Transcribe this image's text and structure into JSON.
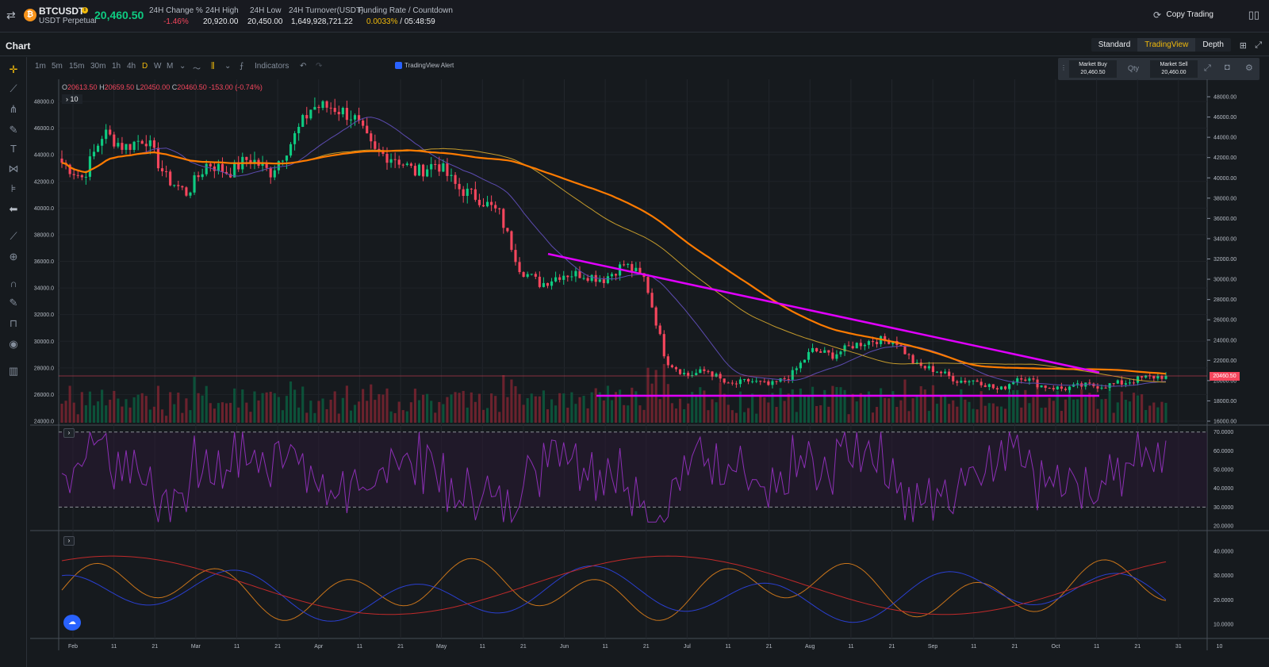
{
  "header": {
    "swap_icon": "swap-arrows-icon",
    "coin_icon": "bitcoin-icon",
    "coin_glyph": "₿",
    "info_glyph": "i",
    "symbol": "BTCUSDT",
    "subtitle": "USDT Perpetual",
    "last_price": "20,460.50",
    "stats": [
      {
        "label": "24H Change %",
        "value": "-1.46%"
      },
      {
        "label": "24H High",
        "value": "20,920.00"
      },
      {
        "label": "24H Low",
        "value": "20,450.00"
      },
      {
        "label": "24H Turnover(USDT)",
        "value": "1,649,928,721.22"
      }
    ],
    "funding": {
      "label": "Funding Rate / Countdown",
      "rate": "0.0033%",
      "countdown": " / 05:48:59"
    },
    "copy_trading": "Copy Trading"
  },
  "chart_panel": {
    "title": "Chart",
    "view_tabs": [
      "Standard",
      "TradingView",
      "Depth"
    ],
    "active_view": "TradingView"
  },
  "toolbar": {
    "timeframes": [
      "1m",
      "5m",
      "15m",
      "30m",
      "1h",
      "4h",
      "D",
      "W",
      "M"
    ],
    "active_timeframe": "D",
    "indicators_label": "Indicators",
    "tv_alert": "TradingView Alert"
  },
  "quick_trade": {
    "buy_label": "Market Buy",
    "buy_price": "20,460.50",
    "qty_label": "Qty",
    "sell_label": "Market Sell",
    "sell_price": "20,460.00"
  },
  "legend": {
    "o_label": "O",
    "o": "20613.50",
    "h_label": "H",
    "h": "20659.50",
    "l_label": "L",
    "l": "20450.00",
    "c_label": "C",
    "c": "20460.50",
    "change": "-153.00 (-0.74%)",
    "study_count": "10"
  },
  "current_price_tag": "20460.50",
  "colors": {
    "up": "#0ecb81",
    "down": "#f6465d",
    "accent": "#f0b90b",
    "trendline": "#e100ff",
    "ema_orange": "#ff7b00",
    "ema_gold": "#c49a2c",
    "ema_purple": "#5c4bb0"
  },
  "chart_data": {
    "type": "candlestick",
    "price_axis_left": [
      "48000.0",
      "46000.0",
      "44000.0",
      "42000.0",
      "40000.0",
      "38000.0",
      "36000.0",
      "34000.0",
      "32000.0",
      "30000.0",
      "28000.0",
      "26000.0",
      "24000.0"
    ],
    "price_axis_right": [
      "48000.00",
      "46000.00",
      "44000.00",
      "42000.00",
      "40000.00",
      "38000.00",
      "36000.00",
      "34000.00",
      "32000.00",
      "30000.00",
      "28000.00",
      "26000.00",
      "24000.00",
      "22000.00",
      "20000.00",
      "18000.00",
      "16000.00"
    ],
    "rsi_axis": [
      "70.0000",
      "60.0000",
      "50.0000",
      "40.0000",
      "30.0000",
      "20.0000"
    ],
    "dmi_axis": [
      "40.0000",
      "30.0000",
      "20.0000",
      "10.0000"
    ],
    "x_labels": [
      "Feb",
      "11",
      "21",
      "Mar",
      "11",
      "21",
      "Apr",
      "11",
      "21",
      "May",
      "11",
      "21",
      "Jun",
      "11",
      "21",
      "Jul",
      "11",
      "21",
      "Aug",
      "11",
      "21",
      "Sep",
      "11",
      "21",
      "Oct",
      "11",
      "21",
      "31",
      "10"
    ],
    "closes_approx": [
      41500,
      40000,
      44500,
      43000,
      44000,
      40000,
      38500,
      41500,
      40500,
      42000,
      40500,
      43500,
      47000,
      47000,
      46000,
      42500,
      42000,
      40500,
      41500,
      39000,
      38000,
      36500,
      31000,
      29500,
      30500,
      30500,
      30000,
      31500,
      30000,
      22000,
      20500,
      21000,
      19500,
      20000,
      19500,
      20500,
      23000,
      22500,
      23500,
      24000,
      24000,
      21500,
      21000,
      20000,
      20000,
      19000,
      20500,
      19500,
      19200,
      19500,
      19500,
      19800,
      20300,
      20460
    ]
  }
}
